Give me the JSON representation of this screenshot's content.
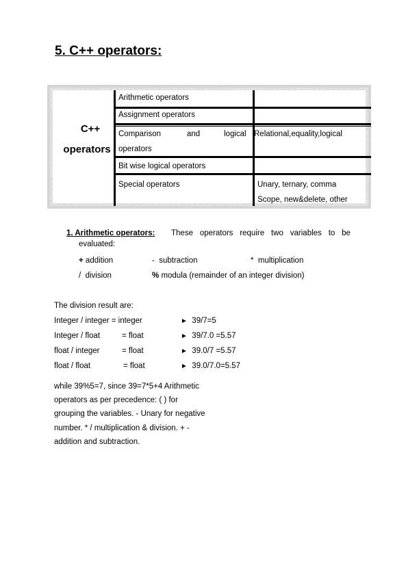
{
  "title": "5. C++ operators:",
  "table": {
    "left_label_line1": "C++",
    "left_label_line2": "operators",
    "rows": [
      {
        "category": "Arithmetic operators",
        "details": ""
      },
      {
        "category": "Assignment operators",
        "details": ""
      },
      {
        "category_parts": [
          "Comparison",
          "and",
          "logical"
        ],
        "category_line2": "operators",
        "details": "Relational,equality,logical"
      },
      {
        "category": "Bit wise logical operators",
        "details": ""
      },
      {
        "category": "Special operators",
        "details_line1": "Unary, ternary, comma",
        "details_line2": "Scope, new&delete, other"
      }
    ]
  },
  "section1": {
    "heading": "1. Arithmetic operators: ",
    "intro_words": [
      "These",
      "operators",
      "require",
      "two",
      "variables",
      "to",
      "be"
    ],
    "intro_line2": "evaluated:",
    "ops": [
      {
        "symbol": "+",
        "label": "addition"
      },
      {
        "symbol": "-",
        "label": "subtraction"
      },
      {
        "symbol": "*",
        "label": "multiplication"
      },
      {
        "symbol": "/",
        "label": "division"
      },
      {
        "symbol": "%",
        "label": "modula (remainder of an integer division)"
      }
    ]
  },
  "division": {
    "heading": "The division result are:",
    "rows": [
      {
        "types": "Integer / integer = integer",
        "lhs": "",
        "result": "",
        "example": "39/7=5"
      },
      {
        "types": "Integer / float",
        "result": "= float",
        "example": "39/7.0 =5.57"
      },
      {
        "types": "float / integer",
        "result": "= float",
        "example": "39.0/7 =5.57"
      },
      {
        "types": "float / float",
        "result": "= float",
        "example": "39.0/7.0=5.57"
      }
    ],
    "arrow_icon": "►"
  },
  "closing": [
    "while 39%5=7, since 39=7*5+4 Arithmetic",
    "operators as per precedence: (  ) for",
    "grouping the variables. - Unary for negative",
    "number. * / multiplication & division. + -",
    "addition and subtraction."
  ]
}
